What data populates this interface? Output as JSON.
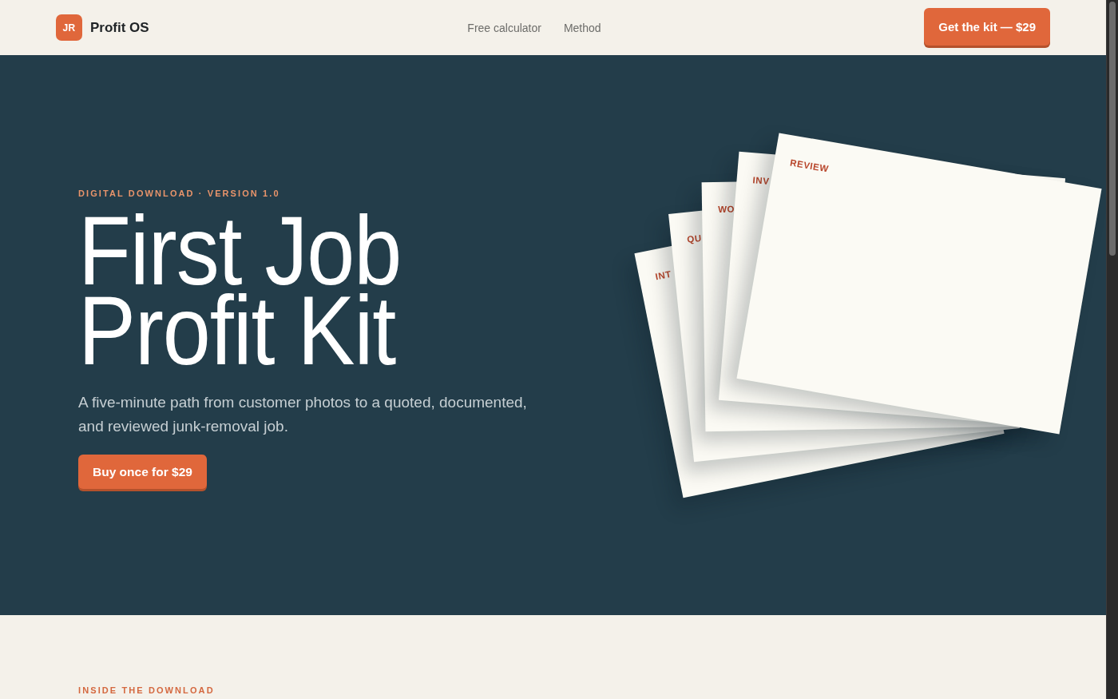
{
  "header": {
    "logo": {
      "initials": "JR",
      "name": "Profit OS"
    },
    "nav": [
      {
        "label": "Free calculator"
      },
      {
        "label": "Method"
      }
    ],
    "cta": "Get the kit — $29"
  },
  "hero": {
    "eyebrow": "DIGITAL DOWNLOAD · VERSION 1.0",
    "title": "First Job Profit Kit",
    "subtitle": "A five-minute path from customer photos to a quoted, documented, and reviewed junk-removal job.",
    "button": "Buy once for $29",
    "cards": [
      {
        "label": "INT"
      },
      {
        "label": "QU"
      },
      {
        "label": "WO"
      },
      {
        "label": "INV"
      },
      {
        "label": "REVIEW"
      }
    ]
  },
  "section": {
    "eyebrow": "INSIDE THE DOWNLOAD"
  }
}
